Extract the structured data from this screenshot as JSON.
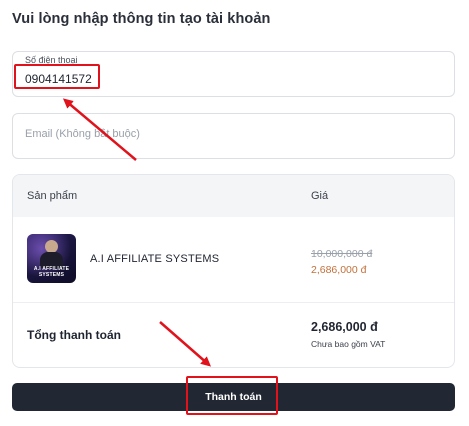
{
  "form": {
    "title": "Vui lòng nhập thông tin tạo tài khoản",
    "phone_label": "Số điện thoại",
    "phone_value": "0904141572",
    "email_placeholder": "Email (Không bắt buộc)"
  },
  "table": {
    "col_product": "Sản phẩm",
    "col_price": "Giá",
    "product": {
      "thumbnail_text": "A.I AFFILIATE SYSTEMS",
      "name": "A.I AFFILIATE SYSTEMS",
      "original_price": "10,000,000 đ",
      "sale_price": "2,686,000 đ"
    },
    "total_label": "Tổng thanh toán",
    "total_amount": "2,686,000 đ",
    "total_note": "Chưa bao gồm VAT"
  },
  "checkout": {
    "pay_label": "Thanh toán"
  },
  "colors": {
    "annotation": "#e0121b",
    "sale_price": "#c2703a",
    "button_bg": "#212733"
  }
}
